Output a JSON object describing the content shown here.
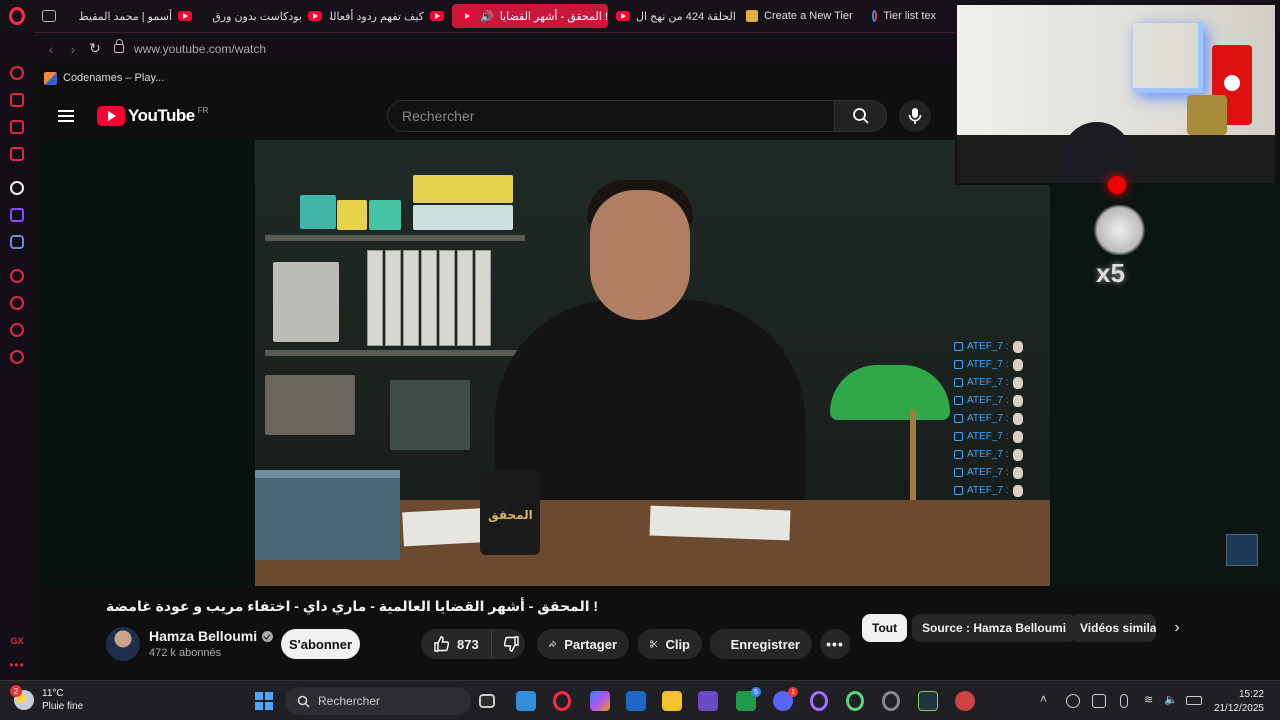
{
  "browser": {
    "tabs": [
      {
        "label": "أسمو | محمد المقيط",
        "active": false
      },
      {
        "label": "بودكاست بدون ورق",
        "active": false
      },
      {
        "label": "كيف تفهم ردود أفعالك",
        "active": false
      },
      {
        "label": "المحقق - أشهر القضايا !",
        "active": true
      },
      {
        "label": "الحلقة 424 من نهج ال",
        "active": false
      },
      {
        "label": "Create a New Tier",
        "active": false
      },
      {
        "label": "Tier list tex",
        "active": false
      }
    ],
    "url": "www.youtube.com/watch",
    "bookmark": "Codenames – Play..."
  },
  "youtube": {
    "logo_text": "YouTube",
    "region": "FR",
    "search_placeholder": "Rechercher"
  },
  "video": {
    "channel_logo_overlay": "المحقق",
    "title": "المحقق - أشهر القضايا العالمية - ماري داي - اختفاء مريب و عودة غامضة !",
    "channel": "Hamza Belloumi",
    "subscribers": "472 k abonnés",
    "subscribe_label": "S'abonner",
    "likes": "873",
    "share_label": "Partager",
    "clip_label": "Clip",
    "save_label": "Enregistrer"
  },
  "stream_overlay": {
    "chat_lines": [
      "ATEF_7 :",
      "ATEF_7 :",
      "ATEF_7 :",
      "ATEF_7 :",
      "ATEF_7 :",
      "ATEF_7 :",
      "ATEF_7 :",
      "ATEF_7 :",
      "ATEF_7 :"
    ],
    "multiplier": "x5"
  },
  "chips": {
    "all": "Tout",
    "source": "Source : Hamza Belloumi",
    "related": "Vidéos similaires"
  },
  "taskbar": {
    "temperature": "11°C",
    "condition": "Pluie fine",
    "notification_count": "2",
    "search_label": "Rechercher",
    "time": "15:22",
    "date": "21/12/2025"
  },
  "colors": {
    "youtube_red": "#ff0033",
    "opera_red": "#e0264b",
    "active_tab": "#c9173c",
    "chat_blue": "#3ea6ff"
  }
}
